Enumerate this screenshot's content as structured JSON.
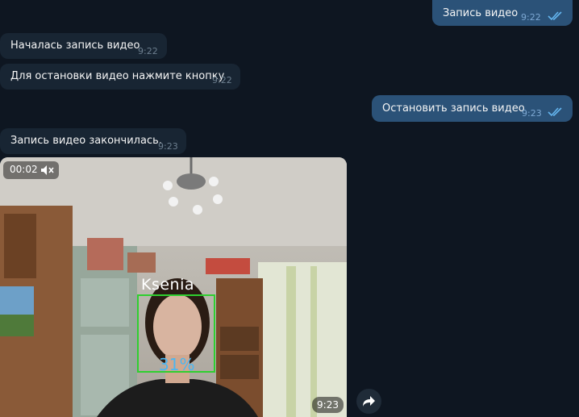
{
  "messages": [
    {
      "text": "Запись видео",
      "time": "9:22",
      "side": "out"
    },
    {
      "text": "Началась запись видео",
      "time": "9:22",
      "side": "in"
    },
    {
      "text": "Для остановки видео нажмите кнопку",
      "time": "9:22",
      "side": "in"
    },
    {
      "text": "Остановить запись видео",
      "time": "9:23",
      "side": "out"
    },
    {
      "text": "Запись видео закончилась.",
      "time": "9:23",
      "side": "in"
    }
  ],
  "video": {
    "duration": "00:02",
    "time": "9:23",
    "face_label": "Ksenia",
    "face_percent": "31%"
  },
  "colors": {
    "background": "#0e1621",
    "incoming": "#182533",
    "outgoing": "#2b5278",
    "face_box": "#2fcf2f",
    "percent": "#4ab6f2"
  },
  "icons": {
    "read": "double-check-icon",
    "mute": "speaker-muted-icon",
    "share": "forward-arrow-icon"
  }
}
